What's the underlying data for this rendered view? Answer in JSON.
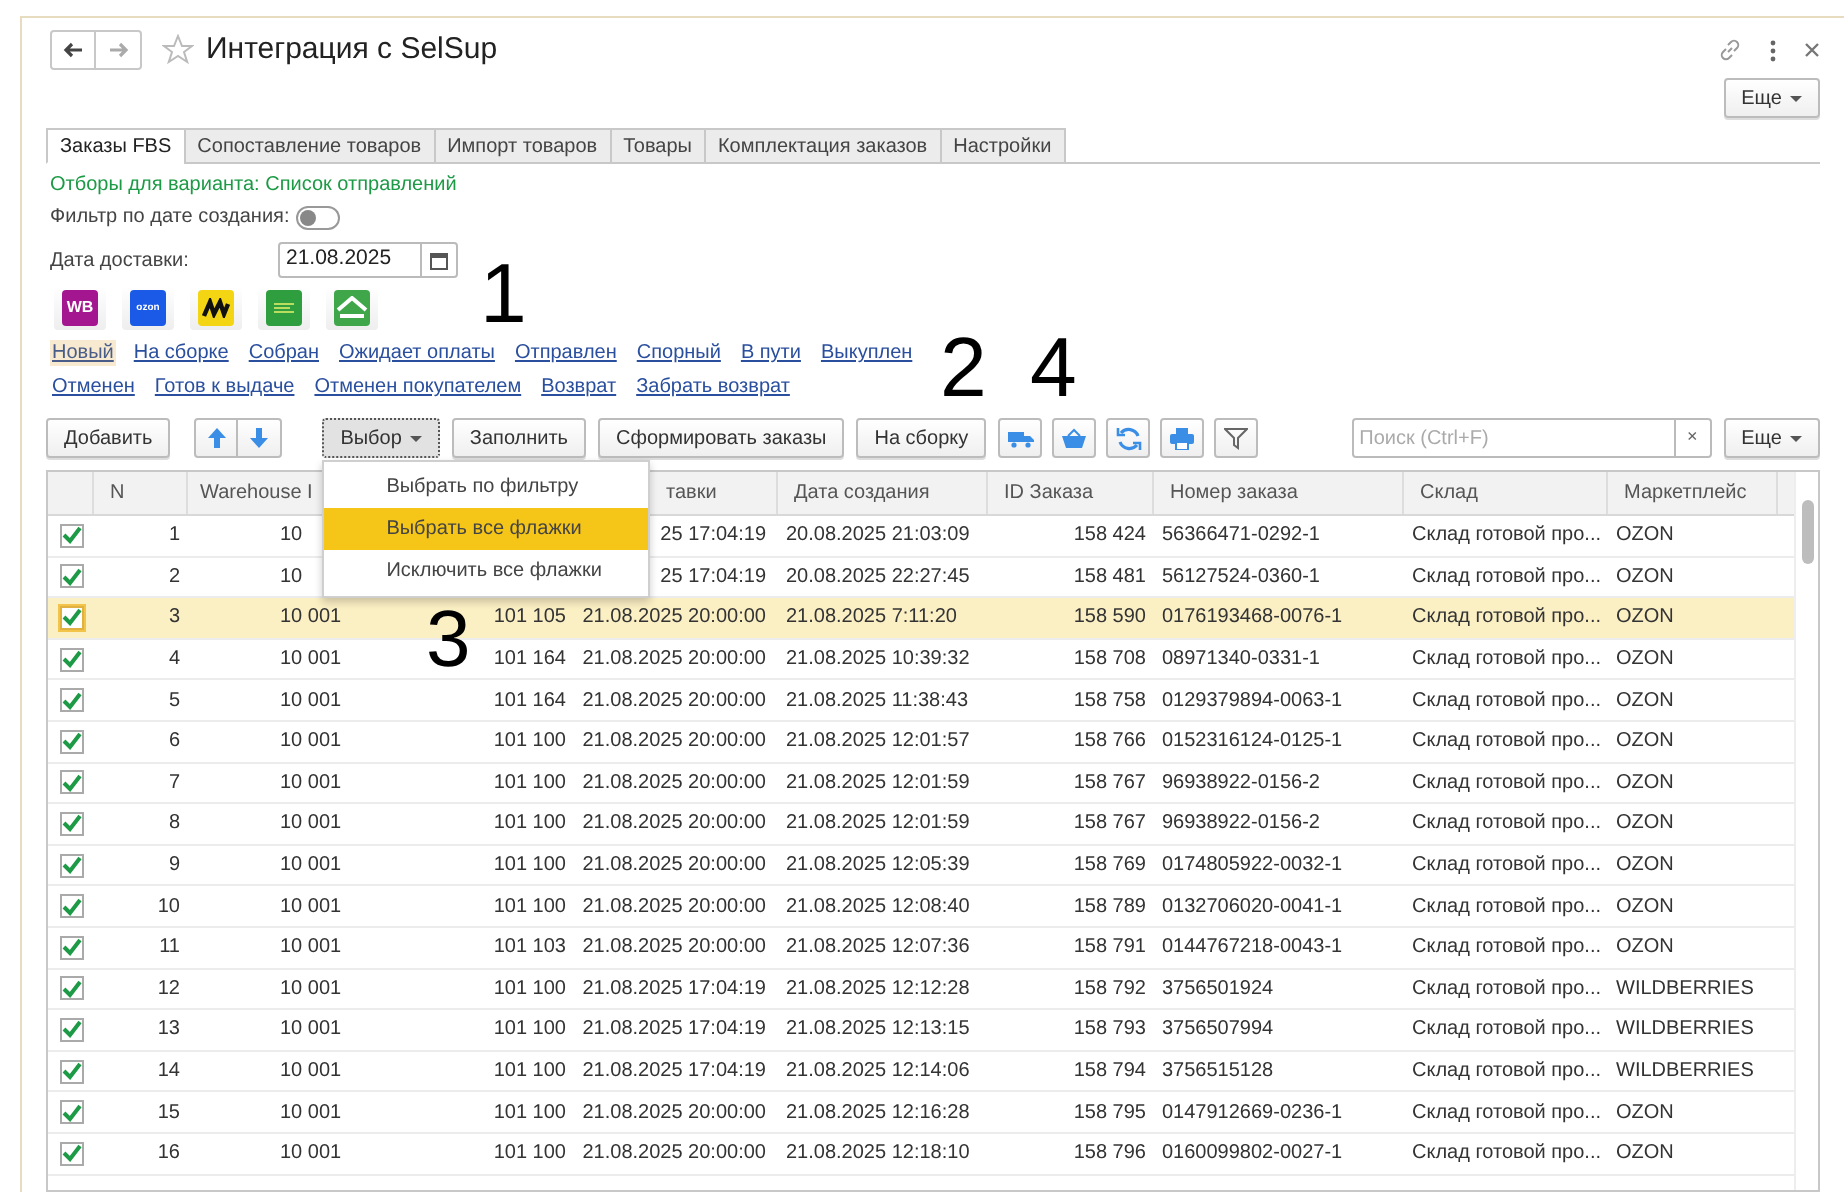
{
  "window": {
    "title": "Интеграция с SelSup",
    "more_button": "Еще"
  },
  "tabs": [
    {
      "label": "Заказы FBS",
      "selected": true
    },
    {
      "label": "Сопоставление товаров",
      "selected": false
    },
    {
      "label": "Импорт товаров",
      "selected": false
    },
    {
      "label": "Товары",
      "selected": false
    },
    {
      "label": "Комплектация заказов",
      "selected": false
    },
    {
      "label": "Настройки",
      "selected": false
    }
  ],
  "filter_note": "Отборы для варианта: Список отправлений",
  "date_filter": {
    "label": "Фильтр по дате создания:",
    "on": false
  },
  "delivery_date": {
    "label": "Дата доставки:",
    "value": "21.08.2025"
  },
  "marketplaces": [
    {
      "kind": "text",
      "label": "WB",
      "color": "#a3168f"
    },
    {
      "kind": "text",
      "label": "ozon",
      "color": "#1a5ae6"
    },
    {
      "kind": "glyph",
      "color": "#f4d514"
    },
    {
      "kind": "lines",
      "color": "#2e9e3e"
    },
    {
      "kind": "roof",
      "color": "#3fa74a"
    }
  ],
  "status_links": [
    [
      {
        "label": "Новый",
        "selected": true
      },
      {
        "label": "На сборке",
        "selected": false
      },
      {
        "label": "Собран",
        "selected": false
      },
      {
        "label": "Ожидает оплаты",
        "selected": false
      },
      {
        "label": "Отправлен",
        "selected": false
      },
      {
        "label": "Спорный",
        "selected": false
      },
      {
        "label": "В пути",
        "selected": false
      },
      {
        "label": "Выкуплен",
        "selected": false
      }
    ],
    [
      {
        "label": "Отменен",
        "selected": false
      },
      {
        "label": "Готов к выдаче",
        "selected": false
      },
      {
        "label": "Отменен покупателем",
        "selected": false
      },
      {
        "label": "Возврат",
        "selected": false
      },
      {
        "label": "Забрать возврат",
        "selected": false
      }
    ]
  ],
  "toolbar": {
    "add": "Добавить",
    "choice": "Выбор",
    "fill": "Заполнить",
    "make_orders": "Сформировать заказы",
    "to_assembly": "На сборку",
    "search_placeholder": "Поиск (Ctrl+F)",
    "clear": "×",
    "more": "Еще"
  },
  "choice_menu": [
    {
      "label": "Выбрать по фильтру",
      "selected": false
    },
    {
      "label": "Выбрать все флажки",
      "selected": true
    },
    {
      "label": "Исключить все флажки",
      "selected": false
    }
  ],
  "table": {
    "columns": [
      "N",
      "Warehouse I",
      "",
      "тавки",
      "Дата создания",
      "ID Заказа",
      "Номер заказа",
      "Склад",
      "Маркетплейс"
    ],
    "rows": [
      {
        "checked": true,
        "selected": false,
        "cells": [
          "1",
          "10",
          "",
          "25 17:04:19",
          "20.08.2025 21:03:09",
          "158 424",
          "56366471-0292-1",
          "Склад готовой про...",
          "OZON"
        ]
      },
      {
        "checked": true,
        "selected": false,
        "cells": [
          "2",
          "10",
          "",
          "25 17:04:19",
          "20.08.2025 22:27:45",
          "158 481",
          "56127524-0360-1",
          "Склад готовой про...",
          "OZON"
        ]
      },
      {
        "checked": true,
        "selected": true,
        "cells": [
          "3",
          "10 001",
          "101 105",
          "21.08.2025 20:00:00",
          "21.08.2025 7:11:20",
          "158 590",
          "0176193468-0076-1",
          "Склад готовой про...",
          "OZON"
        ]
      },
      {
        "checked": true,
        "selected": false,
        "cells": [
          "4",
          "10 001",
          "101 164",
          "21.08.2025 20:00:00",
          "21.08.2025 10:39:32",
          "158 708",
          "08971340-0331-1",
          "Склад готовой про...",
          "OZON"
        ]
      },
      {
        "checked": true,
        "selected": false,
        "cells": [
          "5",
          "10 001",
          "101 164",
          "21.08.2025 20:00:00",
          "21.08.2025 11:38:43",
          "158 758",
          "0129379894-0063-1",
          "Склад готовой про...",
          "OZON"
        ]
      },
      {
        "checked": true,
        "selected": false,
        "cells": [
          "6",
          "10 001",
          "101 100",
          "21.08.2025 20:00:00",
          "21.08.2025 12:01:57",
          "158 766",
          "0152316124-0125-1",
          "Склад готовой про...",
          "OZON"
        ]
      },
      {
        "checked": true,
        "selected": false,
        "cells": [
          "7",
          "10 001",
          "101 100",
          "21.08.2025 20:00:00",
          "21.08.2025 12:01:59",
          "158 767",
          "96938922-0156-2",
          "Склад готовой про...",
          "OZON"
        ]
      },
      {
        "checked": true,
        "selected": false,
        "cells": [
          "8",
          "10 001",
          "101 100",
          "21.08.2025 20:00:00",
          "21.08.2025 12:01:59",
          "158 767",
          "96938922-0156-2",
          "Склад готовой про...",
          "OZON"
        ]
      },
      {
        "checked": true,
        "selected": false,
        "cells": [
          "9",
          "10 001",
          "101 100",
          "21.08.2025 20:00:00",
          "21.08.2025 12:05:39",
          "158 769",
          "0174805922-0032-1",
          "Склад готовой про...",
          "OZON"
        ]
      },
      {
        "checked": true,
        "selected": false,
        "cells": [
          "10",
          "10 001",
          "101 100",
          "21.08.2025 20:00:00",
          "21.08.2025 12:08:40",
          "158 789",
          "0132706020-0041-1",
          "Склад готовой про...",
          "OZON"
        ]
      },
      {
        "checked": true,
        "selected": false,
        "cells": [
          "11",
          "10 001",
          "101 103",
          "21.08.2025 20:00:00",
          "21.08.2025 12:07:36",
          "158 791",
          "0144767218-0043-1",
          "Склад готовой про...",
          "OZON"
        ]
      },
      {
        "checked": true,
        "selected": false,
        "cells": [
          "12",
          "10 001",
          "101 100",
          "21.08.2025 17:04:19",
          "21.08.2025 12:12:28",
          "158 792",
          "3756501924",
          "Склад готовой про...",
          "WILDBERRIES"
        ]
      },
      {
        "checked": true,
        "selected": false,
        "cells": [
          "13",
          "10 001",
          "101 100",
          "21.08.2025 17:04:19",
          "21.08.2025 12:13:15",
          "158 793",
          "3756507994",
          "Склад готовой про...",
          "WILDBERRIES"
        ]
      },
      {
        "checked": true,
        "selected": false,
        "cells": [
          "14",
          "10 001",
          "101 100",
          "21.08.2025 17:04:19",
          "21.08.2025 12:14:06",
          "158 794",
          "3756515128",
          "Склад готовой про...",
          "WILDBERRIES"
        ]
      },
      {
        "checked": true,
        "selected": false,
        "cells": [
          "15",
          "10 001",
          "101 100",
          "21.08.2025 20:00:00",
          "21.08.2025 12:16:28",
          "158 795",
          "0147912669-0236-1",
          "Склад готовой про...",
          "OZON"
        ]
      },
      {
        "checked": true,
        "selected": false,
        "cells": [
          "16",
          "10 001",
          "101 100",
          "21.08.2025 20:00:00",
          "21.08.2025 12:18:10",
          "158 796",
          "0160099802-0027-1",
          "Склад готовой про...",
          "OZON"
        ]
      }
    ]
  },
  "annotations": [
    "1",
    "2",
    "4",
    "3"
  ]
}
